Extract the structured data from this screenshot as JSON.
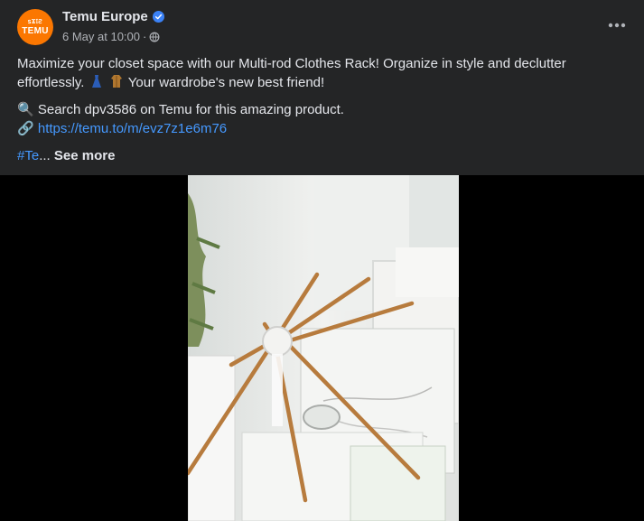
{
  "page": {
    "name": "Temu Europe",
    "timestamp": "6 May at 10:00",
    "separator": "·",
    "avatar_top": "𝗌Ϫ𝔩ϩ",
    "avatar_text": "TEMU",
    "avatar_color": "#fb7701",
    "verified_color": "#3b82f6"
  },
  "post": {
    "line1_a": "Maximize your closet space with our Multi-rod Clothes Rack! Organize in style and declutter effortlessly.",
    "line1_b": "Your wardrobe's new best friend!",
    "line2_icon": "🔍",
    "line2": "Search dpv3586 on Temu for this amazing product.",
    "line3_icon": "🔗",
    "link": "https://temu.to/m/evz7z1e6m76",
    "hashtag": "#Te",
    "ellipsis": "...",
    "see_more": "See more",
    "link_color": "#4599ff"
  },
  "icons": {
    "more": "more-horizontal-icon",
    "globe": "globe-icon",
    "verified": "verified-badge-icon",
    "dress": "dress-emoji",
    "coat": "coat-emoji"
  }
}
